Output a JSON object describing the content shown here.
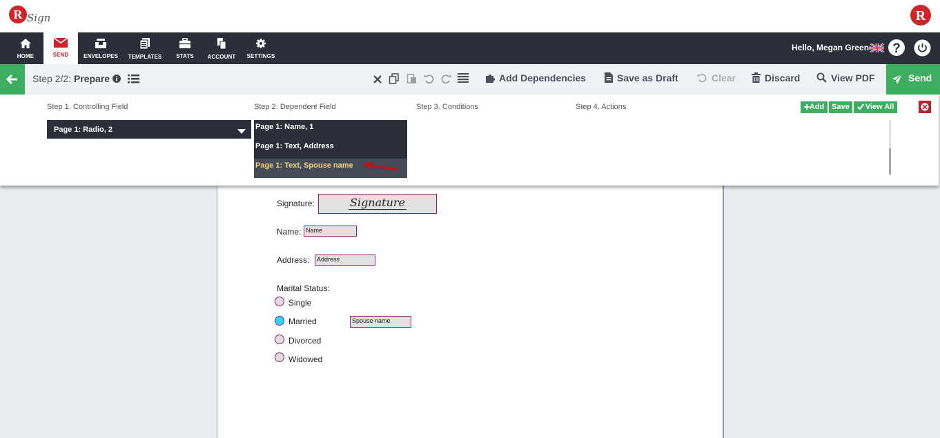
{
  "brand": {
    "logo_letter": "R",
    "logo_text": "Sign",
    "right_logo_letter": "R"
  },
  "nav": {
    "items": [
      {
        "label": "HOME",
        "icon": "home-icon"
      },
      {
        "label": "SEND",
        "icon": "envelope-icon",
        "active": true
      },
      {
        "label": "ENVELOPES",
        "icon": "inbox-icon"
      },
      {
        "label": "TEMPLATES",
        "icon": "templates-icon"
      },
      {
        "label": "STATS",
        "icon": "briefcase-icon"
      },
      {
        "label": "ACCOUNT",
        "icon": "account-icon"
      },
      {
        "label": "SETTINGS",
        "icon": "gear-icon"
      }
    ],
    "greeting": "Hello, Megan Greene"
  },
  "toolbar": {
    "step_prefix": "Step 2/2:",
    "step_name": "Prepare",
    "add_dependencies": "Add Dependencies",
    "save_draft": "Save as Draft",
    "clear": "Clear",
    "discard": "Discard",
    "view_pdf": "View PDF",
    "send": "Send"
  },
  "dependency": {
    "step1": "Step 1. Controlling Field",
    "step2": "Step 2. Dependent Field",
    "step3": "Step 3. Conditions",
    "step4": "Step 4. Actions",
    "controlling_value": "Page 1: Radio, 2",
    "dependent_fields": [
      "Page 1: Name, 1",
      "Page 1: Text, Address",
      "Page 1: Text, Spouse name"
    ],
    "add": "Add",
    "save": "Save",
    "view_all": "View All"
  },
  "document": {
    "signature_label": "Signature:",
    "signature_value": "Signature",
    "name_label": "Name:",
    "name_placeholder": "Name",
    "address_label": "Address:",
    "address_placeholder": "Address",
    "marital_label": "Marital Status:",
    "options": [
      "Single",
      "Married",
      "Divorced",
      "Widowed"
    ],
    "spouse_placeholder": "Spouse name"
  },
  "colors": {
    "accent_green": "#3dae5f",
    "nav_dark": "#2b2f3a",
    "brand_red": "#d0242b",
    "field_border": "#8e1f73",
    "radio_selected": "#27d8ff"
  }
}
